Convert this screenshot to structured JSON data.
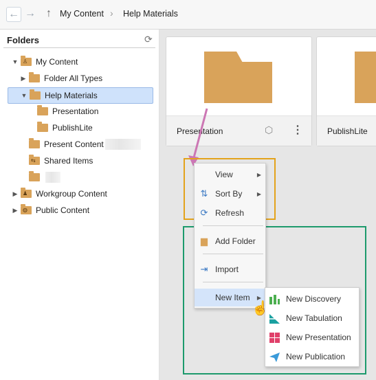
{
  "breadcrumb": {
    "items": [
      "My Content",
      "Help Materials"
    ],
    "separator": "›"
  },
  "folders_panel": {
    "title": "Folders",
    "tree": [
      {
        "label": "My Content"
      },
      {
        "label": "Folder All Types"
      },
      {
        "label": "Help Materials"
      },
      {
        "label": "Presentation"
      },
      {
        "label": "PublishLite"
      },
      {
        "label": "Present Content"
      },
      {
        "label": "Shared Items"
      },
      {
        "label": "Workgroup Content"
      },
      {
        "label": "Public Content"
      }
    ]
  },
  "cards": [
    {
      "name": "Presentation"
    },
    {
      "name": "PublishLite"
    }
  ],
  "context_menu": {
    "items": [
      {
        "label": "View"
      },
      {
        "label": "Sort By"
      },
      {
        "label": "Refresh"
      },
      {
        "label": "Add Folder"
      },
      {
        "label": "Import"
      },
      {
        "label": "New Item"
      }
    ]
  },
  "submenu": {
    "items": [
      {
        "label": "New Discovery"
      },
      {
        "label": "New Tabulation"
      },
      {
        "label": "New Presentation"
      },
      {
        "label": "New Publication"
      }
    ]
  },
  "colors": {
    "folder": "#d9a35a",
    "selection": "#cfe2fb",
    "highlight_orange": "#e3a21a",
    "highlight_green": "#1c9a6c",
    "arrow": "#cc77b4",
    "discovery": "#4caf50",
    "tabulation": "#1aa0a0",
    "presentation": "#e0406a",
    "publication": "#3a9ad9"
  }
}
